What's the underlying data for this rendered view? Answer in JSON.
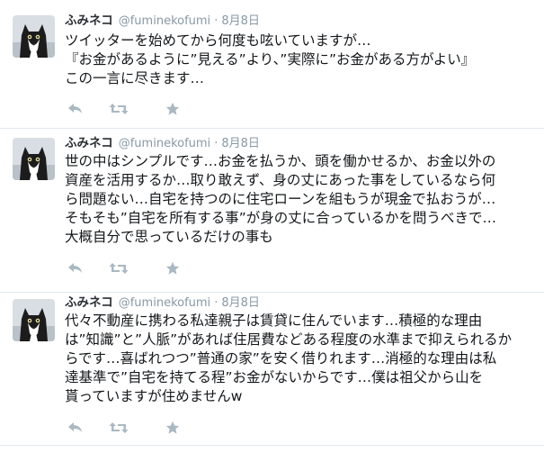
{
  "tweets": [
    {
      "author": {
        "name": "ふみネコ",
        "handle": "@fuminekofumi"
      },
      "separator": "·",
      "time": "8月8日",
      "lines": [
        "ツイッターを始めてから何度も呟いていますが…",
        "『お金があるように”見える”より、”実際に”お金がある方がよい』",
        "この一言に尽きます…"
      ]
    },
    {
      "author": {
        "name": "ふみネコ",
        "handle": "@fuminekofumi"
      },
      "separator": "·",
      "time": "8月8日",
      "lines": [
        "世の中はシンプルです…お金を払うか、頭を働かせるか、お金以外の",
        "資産を活用するか…取り敢えず、身の丈にあった事をしているなら何",
        "ら問題ない…自宅を持つのに住宅ローンを組もうが現金で払おうが…",
        "そもそも”自宅を所有する事”が身の丈に合っているかを問うべきで…",
        "大概自分で思っているだけの事も"
      ]
    },
    {
      "author": {
        "name": "ふみネコ",
        "handle": "@fuminekofumi"
      },
      "separator": "·",
      "time": "8月8日",
      "lines": [
        "代々不動産に携わる私達親子は賃貸に住んでいます…積極的な理由",
        "は”知識”と”人脈”があれば住居費などある程度の水準まで抑えられるか",
        "らです…喜ばれつつ”普通の家”を安く借りれます…消極的な理由は私",
        "達基準で”自宅を持てる程”お金がないからです…僕は祖父から山を",
        "貰っていますが住めませんw"
      ]
    }
  ],
  "colors": {
    "icon": "#aab8c2",
    "meta": "#8899a6",
    "border": "#e1e8ed",
    "text": "#14171a"
  },
  "icons": {
    "reply": "reply-icon",
    "retweet": "retweet-icon",
    "favorite": "star-icon"
  }
}
